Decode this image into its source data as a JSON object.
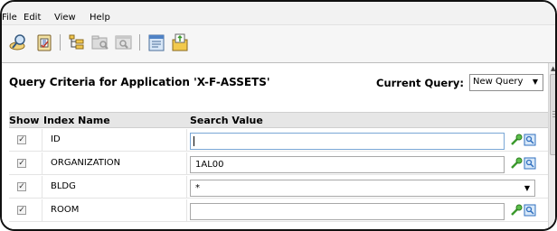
{
  "menu": {
    "items": [
      "File",
      "Edit",
      "View",
      "Help"
    ]
  },
  "toolbar": {
    "buttons": [
      "search-icon",
      "clipboard-icon",
      "tree-icon",
      "folder-search-icon",
      "window-search-icon",
      "document-icon",
      "export-icon"
    ]
  },
  "query": {
    "title": "Query Criteria for Application 'X-F-ASSETS'",
    "current_query_label": "Current Query:",
    "current_query_value": "New Query"
  },
  "table": {
    "headers": {
      "show": "Show",
      "index_name": "Index Name",
      "search_value": "Search Value"
    },
    "rows": [
      {
        "index_name": "ID",
        "value": "",
        "show": true,
        "type": "text"
      },
      {
        "index_name": "ORGANIZATION",
        "value": "1AL00",
        "show": true,
        "type": "text"
      },
      {
        "index_name": "BLDG",
        "value": "*",
        "show": true,
        "type": "dropdown"
      },
      {
        "index_name": "ROOM",
        "value": "",
        "show": true,
        "type": "text"
      }
    ]
  },
  "colors": {
    "header_bg": "#e6e6e6",
    "check": "#333333",
    "accent_blue": "#2f6fbf",
    "accent_green": "#3b9a2d"
  }
}
